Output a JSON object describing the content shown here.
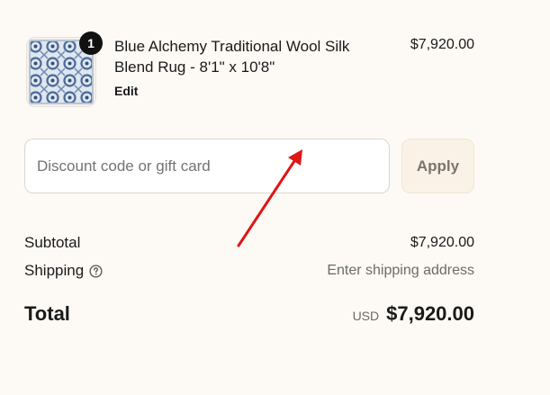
{
  "line_item": {
    "quantity": "1",
    "title": "Blue Alchemy Traditional Wool Silk Blend Rug - 8'1\" x 10'8\"",
    "edit_label": "Edit",
    "price": "$7,920.00"
  },
  "discount": {
    "placeholder": "Discount code or gift card",
    "value": "",
    "apply_label": "Apply"
  },
  "summary": {
    "subtotal_label": "Subtotal",
    "subtotal_value": "$7,920.00",
    "shipping_label": "Shipping",
    "shipping_value": "Enter shipping address",
    "total_label": "Total",
    "currency": "USD",
    "total_value": "$7,920.00"
  },
  "icons": {
    "help": "question-circle-icon",
    "annotation": "red-arrow-icon"
  },
  "colors": {
    "background": "#fdf9f4",
    "apply_button_bg": "#faf2e6",
    "badge_bg": "#111111",
    "annotation_arrow": "#e01515",
    "rug_blue": "#4a6a9a"
  }
}
